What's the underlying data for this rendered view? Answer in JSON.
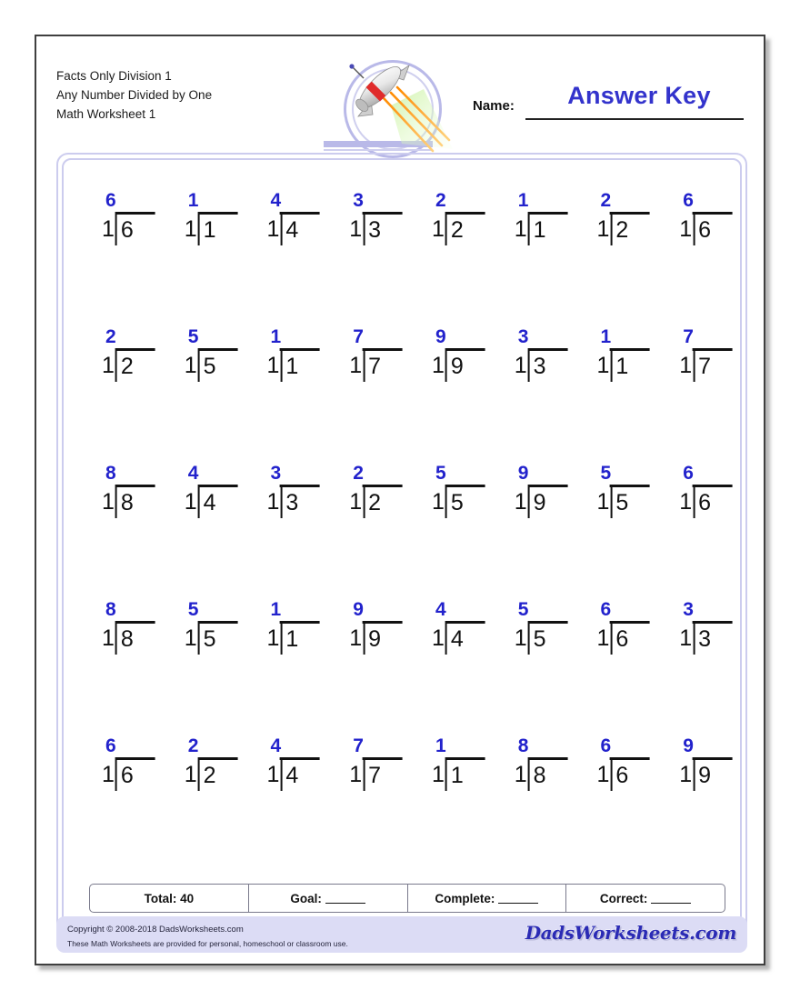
{
  "header": {
    "title_lines": [
      "Facts Only Division 1",
      "Any Number Divided by One",
      "Math Worksheet 1"
    ],
    "name_label": "Name:",
    "answer_key": "Answer Key",
    "rocket_icon": "rocket-icon"
  },
  "grid": {
    "rows": 5,
    "columns": 8,
    "divisor": "1",
    "problems": [
      [
        {
          "divisor": "1",
          "dividend": "6",
          "quotient": "6"
        },
        {
          "divisor": "1",
          "dividend": "1",
          "quotient": "1"
        },
        {
          "divisor": "1",
          "dividend": "4",
          "quotient": "4"
        },
        {
          "divisor": "1",
          "dividend": "3",
          "quotient": "3"
        },
        {
          "divisor": "1",
          "dividend": "2",
          "quotient": "2"
        },
        {
          "divisor": "1",
          "dividend": "1",
          "quotient": "1"
        },
        {
          "divisor": "1",
          "dividend": "2",
          "quotient": "2"
        },
        {
          "divisor": "1",
          "dividend": "6",
          "quotient": "6"
        }
      ],
      [
        {
          "divisor": "1",
          "dividend": "2",
          "quotient": "2"
        },
        {
          "divisor": "1",
          "dividend": "5",
          "quotient": "5"
        },
        {
          "divisor": "1",
          "dividend": "1",
          "quotient": "1"
        },
        {
          "divisor": "1",
          "dividend": "7",
          "quotient": "7"
        },
        {
          "divisor": "1",
          "dividend": "9",
          "quotient": "9"
        },
        {
          "divisor": "1",
          "dividend": "3",
          "quotient": "3"
        },
        {
          "divisor": "1",
          "dividend": "1",
          "quotient": "1"
        },
        {
          "divisor": "1",
          "dividend": "7",
          "quotient": "7"
        }
      ],
      [
        {
          "divisor": "1",
          "dividend": "8",
          "quotient": "8"
        },
        {
          "divisor": "1",
          "dividend": "4",
          "quotient": "4"
        },
        {
          "divisor": "1",
          "dividend": "3",
          "quotient": "3"
        },
        {
          "divisor": "1",
          "dividend": "2",
          "quotient": "2"
        },
        {
          "divisor": "1",
          "dividend": "5",
          "quotient": "5"
        },
        {
          "divisor": "1",
          "dividend": "9",
          "quotient": "9"
        },
        {
          "divisor": "1",
          "dividend": "5",
          "quotient": "5"
        },
        {
          "divisor": "1",
          "dividend": "6",
          "quotient": "6"
        }
      ],
      [
        {
          "divisor": "1",
          "dividend": "8",
          "quotient": "8"
        },
        {
          "divisor": "1",
          "dividend": "5",
          "quotient": "5"
        },
        {
          "divisor": "1",
          "dividend": "1",
          "quotient": "1"
        },
        {
          "divisor": "1",
          "dividend": "9",
          "quotient": "9"
        },
        {
          "divisor": "1",
          "dividend": "4",
          "quotient": "4"
        },
        {
          "divisor": "1",
          "dividend": "5",
          "quotient": "5"
        },
        {
          "divisor": "1",
          "dividend": "6",
          "quotient": "6"
        },
        {
          "divisor": "1",
          "dividend": "3",
          "quotient": "3"
        }
      ],
      [
        {
          "divisor": "1",
          "dividend": "6",
          "quotient": "6"
        },
        {
          "divisor": "1",
          "dividend": "2",
          "quotient": "2"
        },
        {
          "divisor": "1",
          "dividend": "4",
          "quotient": "4"
        },
        {
          "divisor": "1",
          "dividend": "7",
          "quotient": "7"
        },
        {
          "divisor": "1",
          "dividend": "1",
          "quotient": "1"
        },
        {
          "divisor": "1",
          "dividend": "8",
          "quotient": "8"
        },
        {
          "divisor": "1",
          "dividend": "6",
          "quotient": "6"
        },
        {
          "divisor": "1",
          "dividend": "9",
          "quotient": "9"
        }
      ]
    ]
  },
  "stats": {
    "total_label": "Total: 40",
    "goal_label": "Goal:",
    "complete_label": "Complete:",
    "correct_label": "Correct:"
  },
  "footer": {
    "copyright": "Copyright © 2008-2018 DadsWorksheets.com",
    "usage": "These Math Worksheets are provided for personal, homeschool or classroom use.",
    "logo": "DadsWorksheets.com"
  },
  "colors": {
    "quotient_blue": "#2222cc",
    "answer_key_blue": "#3333cc",
    "frame_lavender": "#ccccee",
    "footer_bar": "#dcdcf5"
  }
}
